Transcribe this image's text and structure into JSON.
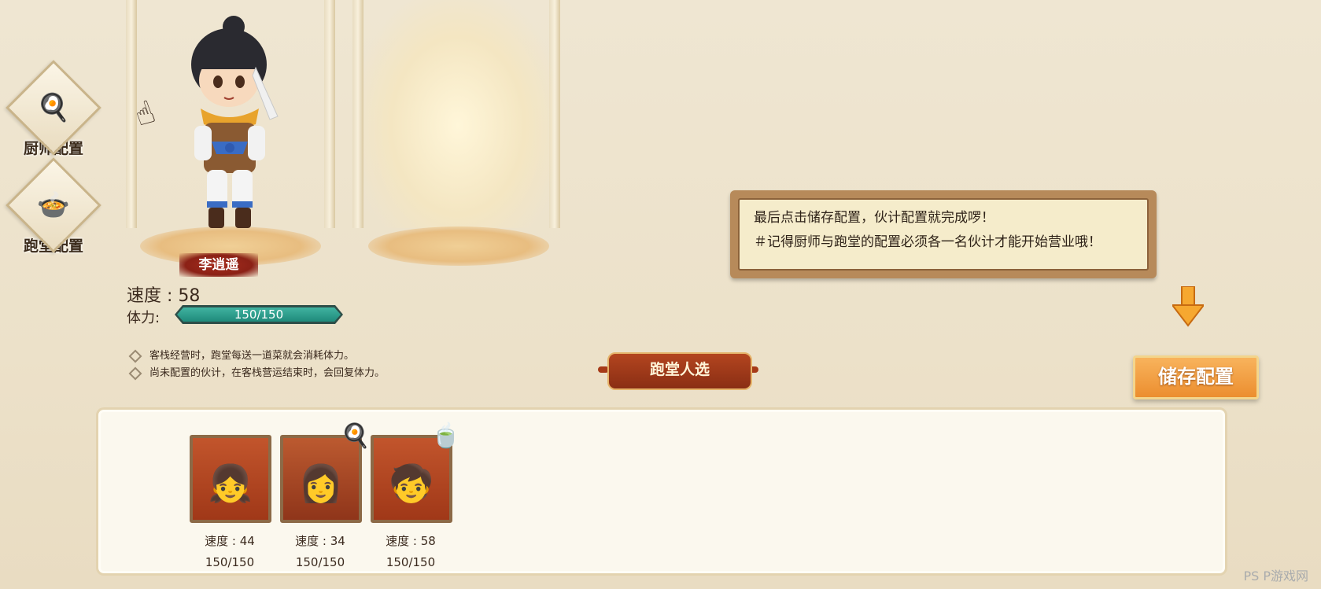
{
  "nav": [
    {
      "label": "厨师配置",
      "icon": "wok-icon"
    },
    {
      "label": "跑堂配置",
      "icon": "bowl-icon"
    }
  ],
  "selected": {
    "name": "李逍遥",
    "speed_text": "速度 : 58",
    "stamina_label": "体力:",
    "stamina_text": "150/150",
    "stamina_fraction": 1.0
  },
  "notes": [
    "客栈经营时，跑堂每送一道菜就会消耗体力。",
    "尚未配置的伙计，在客栈营运结束时，会回复体力。"
  ],
  "tip": {
    "line1": "最后点击储存配置，伙计配置就完成啰！",
    "line2": "＃记得厨师与跑堂的配置必须各一名伙计才能开始营业哦！"
  },
  "section_title": "跑堂人选",
  "save_button": "储存配置",
  "roster": [
    {
      "speed": "速度 : 44",
      "hp": "150/150",
      "face": "👧",
      "badge": ""
    },
    {
      "speed": "速度 : 34",
      "hp": "150/150",
      "face": "👩",
      "badge": "🍳"
    },
    {
      "speed": "速度 : 58",
      "hp": "150/150",
      "face": "🧒",
      "badge": "🍵"
    }
  ],
  "watermark": "PS P游戏网",
  "colors": {
    "accent": "#ec8e2f",
    "title_red": "#8a2e14",
    "stamina": "#1f8a7b"
  }
}
